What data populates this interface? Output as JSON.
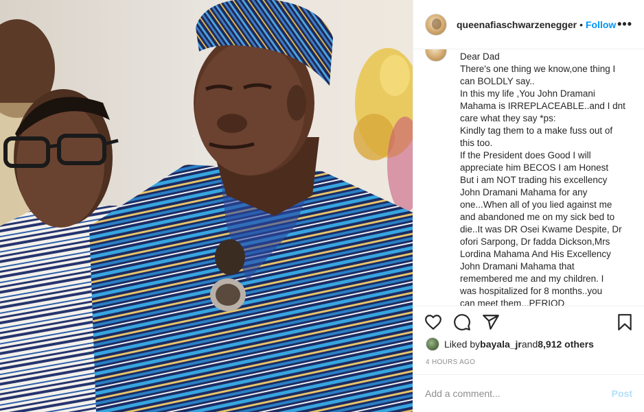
{
  "header": {
    "username": "queenafiaschwarzenegger",
    "separator": "•",
    "follow_label": "Follow",
    "more_label": "•••"
  },
  "caption": {
    "lines": [
      "Dear Dad",
      "There's one thing we know,one thing I",
      "can BOLDLY say..",
      "In this my life ,You John Dramani",
      "Mahama is IRREPLACEABLE..and I dnt",
      "care what they say *ps:",
      "Kindly tag them to a make fuss out of",
      "this too.",
      "If the President does Good I will",
      "appreciate him BECOS I am Honest",
      "But i am NOT trading his excellency",
      "John Dramani Mahama for any",
      "one...When all of you lied against me",
      "and abandoned me on my sick bed to",
      "die..It was DR Osei Kwame Despite, Dr",
      "ofori Sarpong, Dr fadda Dickson,Mrs",
      "Lordina Mahama And His Excellency",
      "John Dramani Mahama that",
      "remembered me and my children. I",
      "was hospitalized for 8 months..you",
      "can meet them...PERIOD"
    ]
  },
  "actions": {
    "like_icon": "heart-icon",
    "comment_icon": "comment-icon",
    "share_icon": "send-icon",
    "save_icon": "bookmark-icon"
  },
  "likes": {
    "prefix": "Liked by ",
    "user": "bayala_jr",
    "middle": " and ",
    "count": "8,912 others"
  },
  "timestamp": "4 HOURS AGO",
  "comment": {
    "placeholder": "Add a comment...",
    "post_label": "Post"
  },
  "colors": {
    "follow_blue": "#0095f6",
    "post_disabled": "#b2dffc",
    "muted": "#8e8e8e",
    "text": "#262626"
  }
}
